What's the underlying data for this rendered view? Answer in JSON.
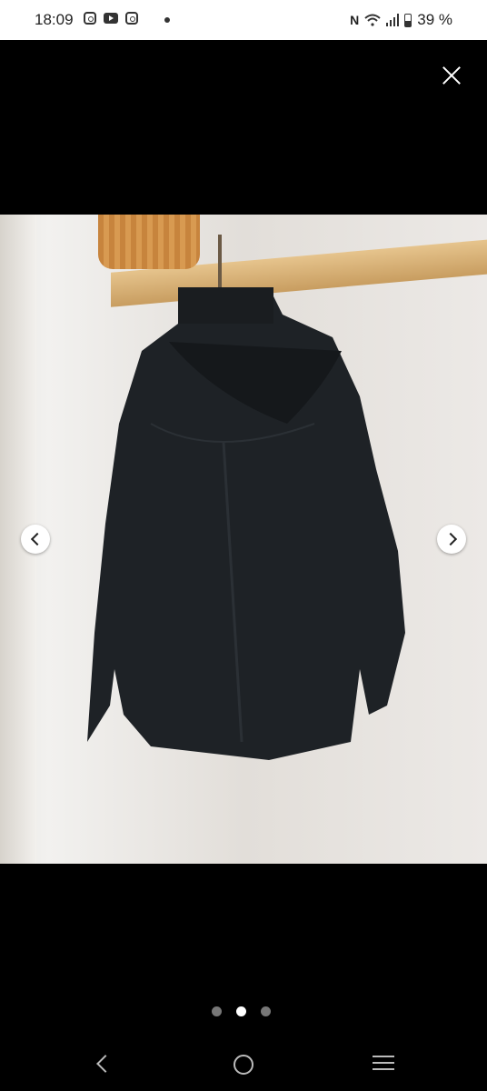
{
  "status_bar": {
    "time": "18:09",
    "battery": "39 %"
  },
  "viewer": {
    "image_count": 3,
    "active_index": 1
  },
  "icons": {
    "close": "close-icon",
    "prev": "chevron-left-icon",
    "next": "chevron-right-icon",
    "back": "back-icon",
    "home": "home-icon",
    "recents": "recents-icon"
  }
}
